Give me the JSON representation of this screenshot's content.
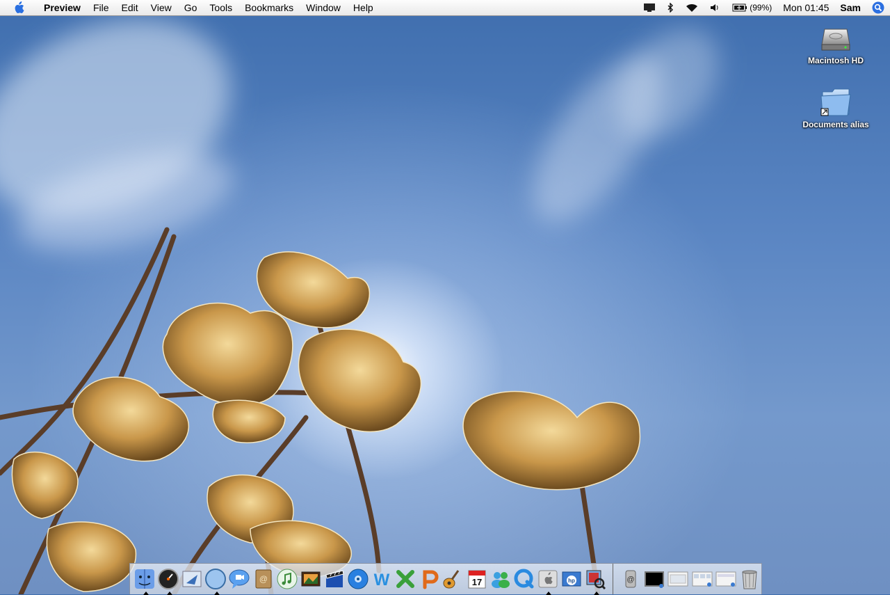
{
  "menubar": {
    "apple_icon": "apple-icon",
    "app_name": "Preview",
    "menus": [
      "File",
      "Edit",
      "View",
      "Go",
      "Tools",
      "Bookmarks",
      "Window",
      "Help"
    ],
    "status": {
      "display_icon": "display-icon",
      "bluetooth_icon": "bluetooth-icon",
      "wifi_icon": "wifi-icon",
      "volume_icon": "volume-icon",
      "battery_icon": "battery-icon",
      "battery_text": "(99%)",
      "clock": "Mon 01:45",
      "user": "Sam",
      "spotlight_icon": "spotlight-icon"
    }
  },
  "desktop": {
    "icons": [
      {
        "label": "Macintosh HD",
        "icon": "hard-drive-icon"
      },
      {
        "label": "Documents alias",
        "icon": "folder-alias-icon"
      }
    ]
  },
  "dock": {
    "apps": [
      {
        "name": "finder-icon",
        "running": true
      },
      {
        "name": "dashboard-icon",
        "running": true
      },
      {
        "name": "mail-icon",
        "running": false
      },
      {
        "name": "safari-icon",
        "running": true
      },
      {
        "name": "ichat-icon",
        "running": false
      },
      {
        "name": "address-book-icon",
        "running": false
      },
      {
        "name": "itunes-icon",
        "running": false
      },
      {
        "name": "iphoto-icon",
        "running": false
      },
      {
        "name": "imovie-icon",
        "running": false
      },
      {
        "name": "idvd-icon",
        "running": false
      },
      {
        "name": "iweb-icon",
        "running": false
      },
      {
        "name": "excel-icon",
        "running": false
      },
      {
        "name": "powerpoint-icon",
        "running": false
      },
      {
        "name": "garageband-icon",
        "running": false
      },
      {
        "name": "ical-icon",
        "running": false,
        "text": "17"
      },
      {
        "name": "msn-messenger-icon",
        "running": false
      },
      {
        "name": "quicktime-icon",
        "running": false
      },
      {
        "name": "system-preferences-icon",
        "running": true
      },
      {
        "name": "hp-printer-icon",
        "running": false
      },
      {
        "name": "preview-icon",
        "running": true
      }
    ],
    "others": [
      {
        "name": "internet-connect-icon"
      },
      {
        "name": "terminal-icon"
      },
      {
        "name": "minimized-window-icon"
      },
      {
        "name": "minimized-window-icon"
      },
      {
        "name": "minimized-window-icon"
      },
      {
        "name": "trash-icon"
      }
    ]
  }
}
